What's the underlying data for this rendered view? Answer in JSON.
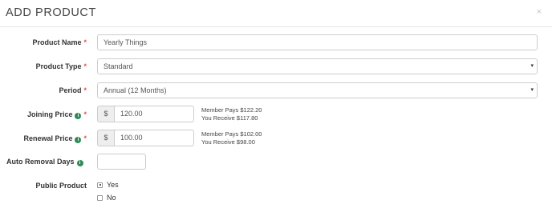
{
  "modal": {
    "title": "ADD PRODUCT",
    "close_symbol": "×"
  },
  "fields": {
    "product_name": {
      "label": "Product Name",
      "required": "*",
      "value": "Yearly Things"
    },
    "product_type": {
      "label": "Product Type",
      "required": "*",
      "value": "Standard",
      "caret": "▾"
    },
    "period": {
      "label": "Period",
      "required": "*",
      "value": "Annual (12 Months)",
      "caret": "▾"
    },
    "joining_price": {
      "label": "Joining Price",
      "required": "*",
      "info_icon": "i",
      "currency": "$",
      "value": "120.00",
      "member_pays": "Member Pays $122.20",
      "you_receive": "You Receive $117.80"
    },
    "renewal_price": {
      "label": "Renewal Price",
      "required": "*",
      "info_icon": "i",
      "currency": "$",
      "value": "100.00",
      "member_pays": "Member Pays $102.00",
      "you_receive": "You Receive $98.00"
    },
    "auto_removal_days": {
      "label": "Auto Removal Days",
      "info_icon": "i",
      "value": ""
    },
    "public_product": {
      "label": "Public Product",
      "options": [
        {
          "label": "Yes",
          "selected": true
        },
        {
          "label": "No",
          "selected": false
        }
      ]
    }
  }
}
